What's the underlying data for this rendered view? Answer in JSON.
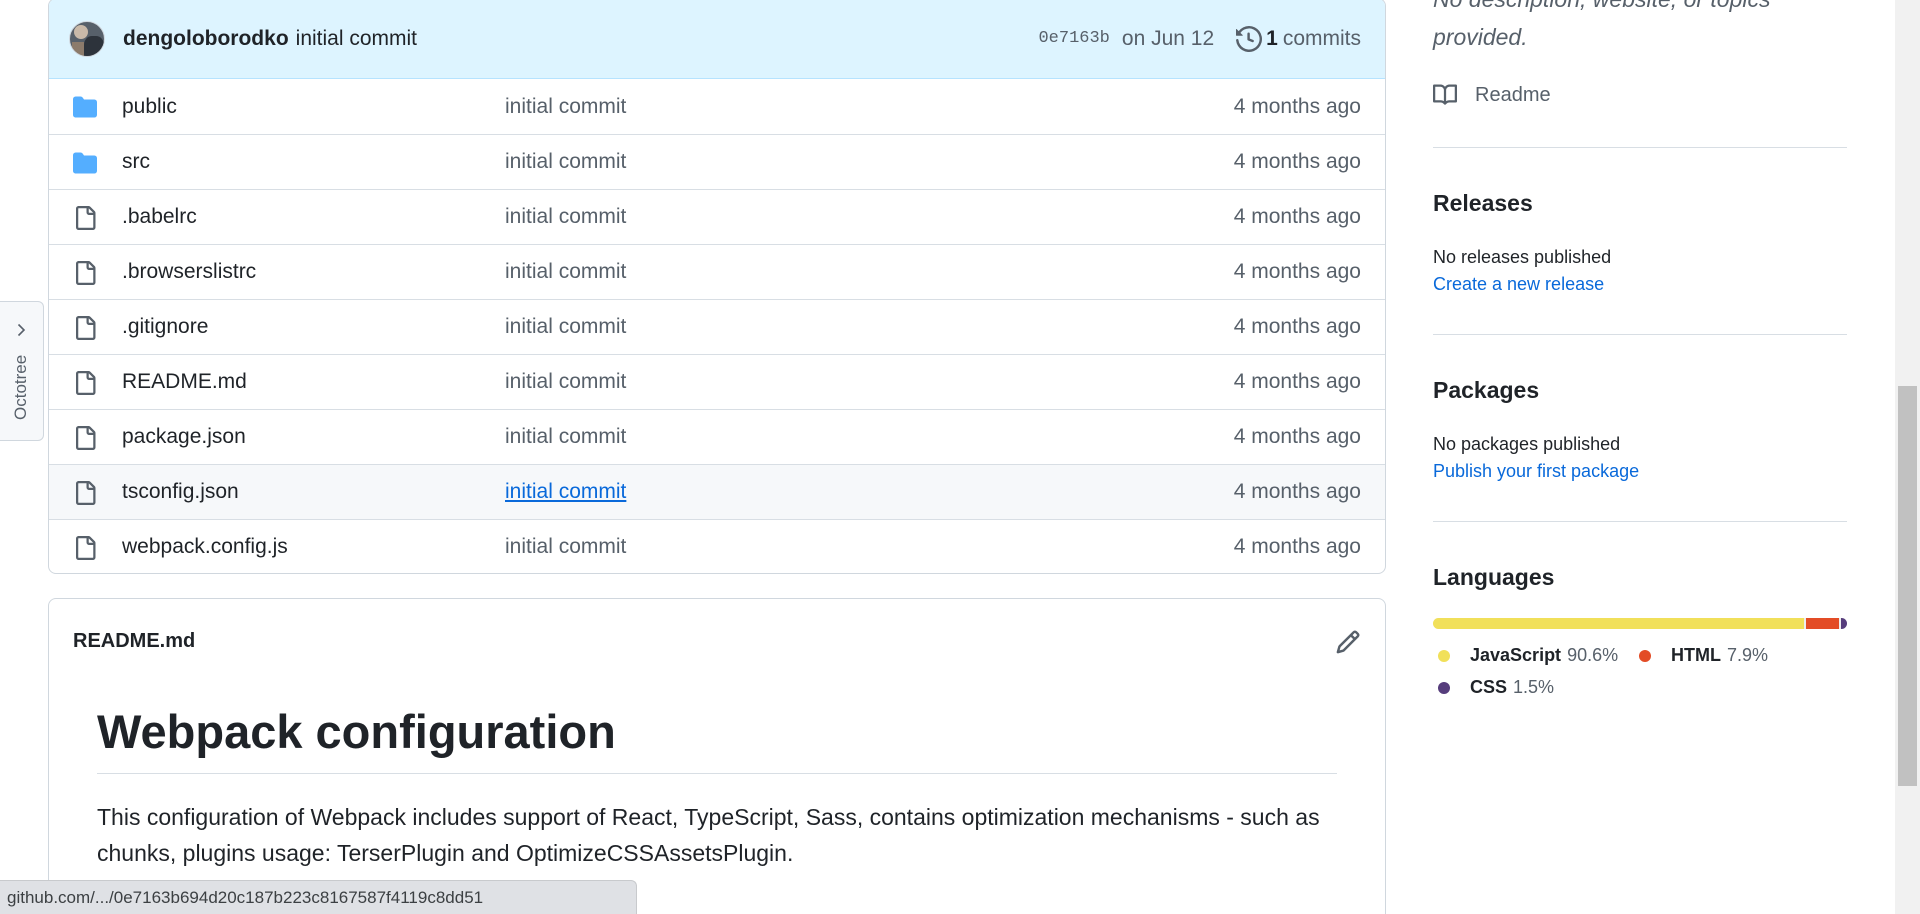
{
  "commit_header": {
    "author": "dengoloborodko",
    "message": "initial commit",
    "sha": "0e7163b",
    "date": "on Jun 12",
    "commit_count": "1",
    "commit_count_label": "commits"
  },
  "files": [
    {
      "name": "public",
      "type": "folder",
      "commit": "initial commit",
      "age": "4 months ago"
    },
    {
      "name": "src",
      "type": "folder",
      "commit": "initial commit",
      "age": "4 months ago"
    },
    {
      "name": ".babelrc",
      "type": "file",
      "commit": "initial commit",
      "age": "4 months ago"
    },
    {
      "name": ".browserslistrc",
      "type": "file",
      "commit": "initial commit",
      "age": "4 months ago"
    },
    {
      "name": ".gitignore",
      "type": "file",
      "commit": "initial commit",
      "age": "4 months ago"
    },
    {
      "name": "README.md",
      "type": "file",
      "commit": "initial commit",
      "age": "4 months ago"
    },
    {
      "name": "package.json",
      "type": "file",
      "commit": "initial commit",
      "age": "4 months ago"
    },
    {
      "name": "tsconfig.json",
      "type": "file",
      "commit": "initial commit",
      "age": "4 months ago"
    },
    {
      "name": "webpack.config.js",
      "type": "file",
      "commit": "initial commit",
      "age": "4 months ago"
    }
  ],
  "readme": {
    "title": "README.md",
    "heading": "Webpack configuration",
    "paragraph": "This configuration of Webpack includes support of React, TypeScript, Sass, contains optimization mechanisms - such as chunks, plugins usage: TerserPlugin and OptimizeCSSAssetsPlugin."
  },
  "sidebar": {
    "about_description": "No description, website, or topics provided.",
    "readme_link": "Readme",
    "releases": {
      "heading": "Releases",
      "text": "No releases published",
      "link": "Create a new release"
    },
    "packages": {
      "heading": "Packages",
      "text": "No packages published",
      "link": "Publish your first package"
    },
    "languages": {
      "heading": "Languages",
      "items": [
        {
          "name": "JavaScript",
          "percent": "90.6%",
          "value": 90.6,
          "color": "#f1e05a"
        },
        {
          "name": "HTML",
          "percent": "7.9%",
          "value": 7.9,
          "color": "#e34c26"
        },
        {
          "name": "CSS",
          "percent": "1.5%",
          "value": 1.5,
          "color": "#563d7c"
        }
      ]
    }
  },
  "octotree": {
    "label": "Octotree"
  },
  "status_bar": {
    "url": "github.com/.../0e7163b694d20c187b223c8167587f4119c8dd51"
  },
  "colors": {
    "link": "#0969da",
    "folder": "#54aeff",
    "header_bg": "#ddf4ff"
  }
}
